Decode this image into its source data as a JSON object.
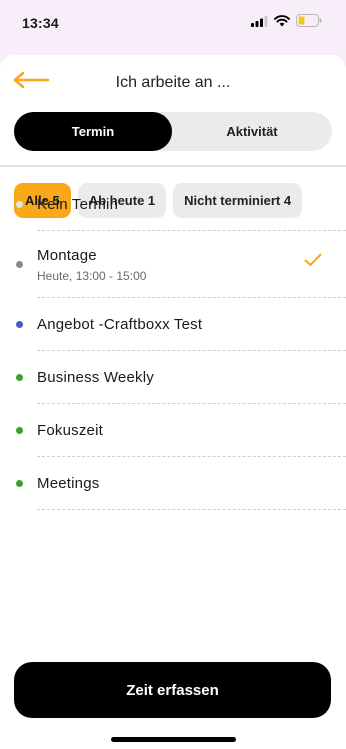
{
  "status_bar": {
    "time": "13:34"
  },
  "header": {
    "title": "Ich arbeite an ...",
    "back_icon": "arrow-left-icon"
  },
  "segments": [
    {
      "label": "Termin",
      "active": true
    },
    {
      "label": "Aktivität",
      "active": false
    }
  ],
  "filters": [
    {
      "label": "Alle 5",
      "active": true
    },
    {
      "label": "Ab heute 1",
      "active": false
    },
    {
      "label": "Nicht terminiert 4",
      "active": false
    }
  ],
  "items": [
    {
      "title": "Kein Termin",
      "subtitle": "",
      "dot_color": "#e2e2e2",
      "selected": false
    },
    {
      "title": "Montage",
      "subtitle": "Heute, 13:00 - 15:00",
      "dot_color": "#8a8a8a",
      "selected": true
    },
    {
      "title": "Angebot -Craftboxx Test",
      "subtitle": "",
      "dot_color": "#3a5fc8",
      "selected": false
    },
    {
      "title": "Business Weekly",
      "subtitle": "",
      "dot_color": "#3aa12a",
      "selected": false
    },
    {
      "title": "Fokuszeit",
      "subtitle": "",
      "dot_color": "#3aa12a",
      "selected": false
    },
    {
      "title": "Meetings",
      "subtitle": "",
      "dot_color": "#3aa12a",
      "selected": false
    }
  ],
  "cta": {
    "label": "Zeit erfassen"
  },
  "colors": {
    "accent": "#f8a818",
    "primary": "#000000",
    "battery_level": "#f5c518"
  }
}
